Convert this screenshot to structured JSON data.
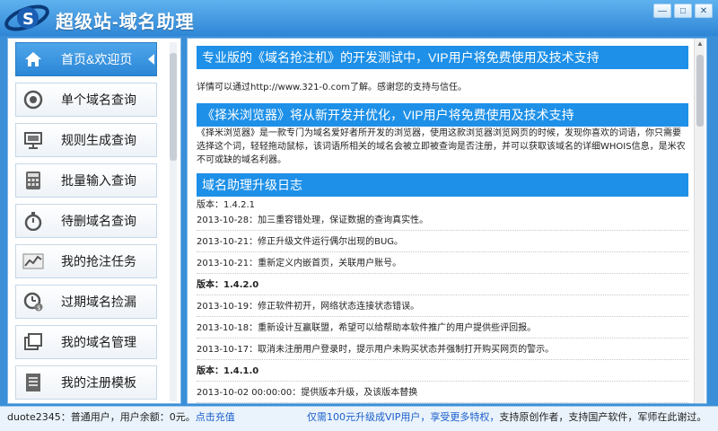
{
  "window": {
    "title": "超级站-域名助理",
    "controls": [
      "—",
      "□",
      "✕"
    ]
  },
  "sidebar": {
    "items": [
      {
        "label": "首页&欢迎页",
        "icon": "home-icon",
        "active": true
      },
      {
        "label": "单个域名查询",
        "icon": "target-icon",
        "active": false
      },
      {
        "label": "规则生成查询",
        "icon": "presentation-icon",
        "active": false
      },
      {
        "label": "批量输入查询",
        "icon": "calculator-icon",
        "active": false
      },
      {
        "label": "待删域名查询",
        "icon": "stopwatch-icon",
        "active": false
      },
      {
        "label": "我的抢注任务",
        "icon": "chart-icon",
        "active": false
      },
      {
        "label": "过期域名捡漏",
        "icon": "clock-dollar-icon",
        "active": false
      },
      {
        "label": "我的域名管理",
        "icon": "windows-icon",
        "active": false
      },
      {
        "label": "我的注册模板",
        "icon": "template-icon",
        "active": false
      }
    ]
  },
  "main": {
    "sections": [
      {
        "heading": "专业版的《域名抢注机》的开发测试中，VIP用户将免费使用及技术支持",
        "body": "详情可以通过http://www.321-0.com了解。感谢您的支持与信任。"
      },
      {
        "heading": "《择米浏览器》将从新开发并优化，VIP用户将免费使用及技术支持",
        "body": "《择米浏览器》是一款专门为域名爱好者所开发的浏览器，使用这款浏览器浏览网页的时候，发现你喜欢的词语，你只需要选择这个词，轻轻拖动鼠标，该词语所相关的域名会被立即被查询是否注册，并可以获取该域名的详细WHOIS信息，是米农不可或缺的域名利器。"
      },
      {
        "heading": "域名助理升级日志",
        "body": ""
      }
    ],
    "log": [
      {
        "text": "版本：1.4.2.1",
        "version": true
      },
      {
        "text": "2013-10-28：加三重容错处理，保证数据的查询真实性。",
        "version": false
      },
      {
        "text": "2013-10-21：修正升级文件运行偶尔出现的BUG。",
        "version": false
      },
      {
        "text": "2013-10-21：重新定义内嵌首页，关联用户账号。",
        "version": false
      },
      {
        "text": "版本：1.4.2.0",
        "version": true
      },
      {
        "text": "2013-10-19：修正软件初开，网络状态连接状态错误。",
        "version": false
      },
      {
        "text": "2013-10-18：重新设计互赢联盟，希望可以给帮助本软件推广的用户提供些评回报。",
        "version": false
      },
      {
        "text": "2013-10-17：取消未注册用户登录时，提示用户未购买状态并强制打开购买网页的警示。",
        "version": false
      },
      {
        "text": "版本：1.4.1.0",
        "version": true
      },
      {
        "text": "2013-10-02 00:00:00：提供版本升级，及该版本替换",
        "version": false
      }
    ]
  },
  "status": {
    "user_info": "duote2345：普通用户，用户余额：0元。",
    "recharge_link": "点击充值",
    "promo": "仅需100元升级成VIP用户，享受更多特权，",
    "message": "支持原创作者，支持国产软件，军师在此谢过。"
  },
  "colors": {
    "accent": "#1e90e8",
    "titlebar": "#3a8fd8",
    "link": "#1b5fcc"
  }
}
